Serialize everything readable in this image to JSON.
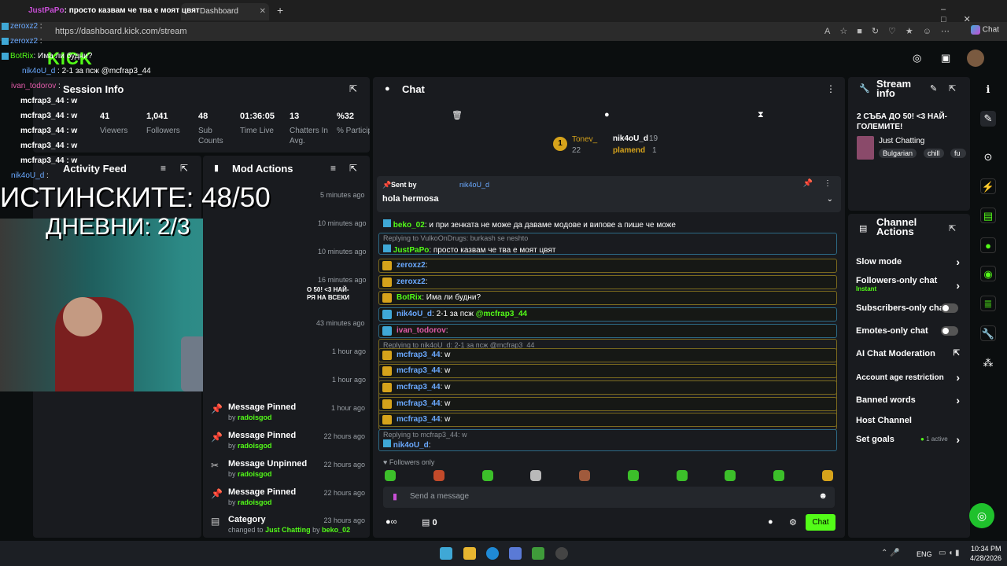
{
  "browser": {
    "tab_title": "Dashboard",
    "url": "https://dashboard.kick.com/stream",
    "chat_button": "Chat"
  },
  "overlay": {
    "top_line_name": "JustPaPo",
    "top_line_text": "просто казвам че тва е моят цвят",
    "lines": [
      {
        "name": "zeroxz2",
        "text": ":"
      },
      {
        "name": "zeroxz2",
        "text": ":"
      },
      {
        "name": "BotRix",
        "text": ": Има ли будни?"
      },
      {
        "name": "nik4oU_d",
        "text": ": 2-1 за псж @mcfrap3_44"
      },
      {
        "name": "ivan_todorov",
        "text": ":"
      },
      {
        "name": "mcfrap3_44",
        "text": ": w"
      },
      {
        "name": "mcfrap3_44",
        "text": ": w"
      },
      {
        "name": "mcfrap3_44",
        "text": ": w"
      },
      {
        "name": "mcfrap3_44",
        "text": ": w"
      },
      {
        "name": "mcfrap3_44",
        "text": ": w"
      },
      {
        "name": "nik4oU_d",
        "text": ":"
      }
    ],
    "big_line1": "ИСТИНСКИТЕ: 48/50",
    "big_line2": "ДНЕВНИ: 2/3"
  },
  "session": {
    "title": "Session Info",
    "stats": [
      {
        "value": "41",
        "label": "Viewers"
      },
      {
        "value": "1,041",
        "label": "Followers"
      },
      {
        "value": "48",
        "label": "Sub Counts"
      },
      {
        "value": "01:36:05",
        "label": "Time Live"
      },
      {
        "value": "13",
        "label": "Chatters In Avg."
      },
      {
        "value": "%32",
        "label": "% Participat"
      }
    ]
  },
  "activity": {
    "title": "Activity Feed"
  },
  "mod_actions": {
    "title": "Mod Actions",
    "partial_text1": "О 50! <3 НАЙ-",
    "partial_text2": "РЯ НА ВСЕКИ",
    "times_top": [
      "5 minutes ago",
      "10 minutes ago",
      "10 minutes ago",
      "16 minutes ago",
      "43 minutes ago",
      "1 hour ago",
      "1 hour ago"
    ],
    "rows": [
      {
        "title": "Message Pinned",
        "by": "by",
        "user": "radoisgod",
        "time": "1 hour ago"
      },
      {
        "title": "Message Pinned",
        "by": "by",
        "user": "radoisgod",
        "time": "22 hours ago"
      },
      {
        "title": "Message Unpinned",
        "by": "by",
        "user": "radoisgod",
        "time": "22 hours ago"
      },
      {
        "title": "Message Pinned",
        "by": "by",
        "user": "radoisgod",
        "time": "22 hours ago"
      },
      {
        "title": "Category",
        "by": "changed to",
        "user": "Just Chatting",
        "by2": "by",
        "user2": "beko_02",
        "time": "23 hours ago"
      }
    ]
  },
  "chat": {
    "title": "Chat",
    "top_gifter": {
      "rank": "1",
      "name": "Tonev_",
      "count": "22"
    },
    "top_users": [
      {
        "name": "nik4oU_d",
        "count": "19"
      },
      {
        "name": "plamend",
        "count": "1"
      }
    ],
    "pinned": {
      "label": "Sent by",
      "user": "nik4oU_d",
      "text": "hola hermosa"
    },
    "first_message": {
      "user": "beko_02",
      "text": ": и при зенката не може да даваме модове и випове а пише че може"
    },
    "reply1": "Replying to VulkoOnDrugs: burkash se neshto",
    "messages": [
      {
        "user": "JustPaPo",
        "text": ": просто казвам че тва е моят цвят",
        "style": "blue"
      },
      {
        "user": "zeroxz2",
        "text": ":",
        "style": "gold"
      },
      {
        "user": "zeroxz2",
        "text": ":",
        "style": "gold"
      },
      {
        "user": "BotRix",
        "text": ": Има ли будни?",
        "style": "gold"
      },
      {
        "user": "nik4oU_d",
        "text": ": 2-1 за псж",
        "mention": "@mcfrap3_44",
        "style": "blue"
      },
      {
        "user": "ivan_todorov",
        "text": ":",
        "style": "blue"
      }
    ],
    "reply2": "Replying to nik4oU_d: 2-1 за псж @mcfrap3_44",
    "w_messages": [
      {
        "user": "mcfrap3_44",
        "text": ": w"
      },
      {
        "user": "mcfrap3_44",
        "text": ": w"
      },
      {
        "user": "mcfrap3_44",
        "text": ": w"
      },
      {
        "user": "mcfrap3_44",
        "text": ": w"
      },
      {
        "user": "mcfrap3_44",
        "text": ": w"
      }
    ],
    "reply3": "Replying to mcfrap3_44: w",
    "last_message": {
      "user": "nik4oU_d",
      "text": ":"
    },
    "followers_only": "Followers only",
    "input_placeholder": "Send a message",
    "infinity": "∞",
    "counter": "0",
    "send_label": "Chat"
  },
  "stream_info": {
    "title": "Stream info",
    "stream_title": "2 СЪБА ДО 50! <3 НАЙ-ГОЛЕМИТЕ!",
    "category": "Just Chatting",
    "tags": [
      "Bulgarian",
      "chill",
      "fu"
    ]
  },
  "channel_actions": {
    "title": "Channel Actions",
    "slow_mode": "Slow mode",
    "followers_only": "Followers-only chat",
    "followers_only_sub": "Instant",
    "subscribers_only": "Subscribers-only chat",
    "emotes_only": "Emotes-only chat",
    "ai_moderation": "AI Chat Moderation",
    "account_age": "Account age restriction",
    "banned_words": "Banned words",
    "host_channel": "Host Channel",
    "set_goals": "Set goals",
    "set_goals_status": "1 active"
  },
  "taskbar": {
    "lang": "ENG",
    "time": "10:34 PM",
    "date": "4/28/2026"
  },
  "colors": {
    "kick_green": "#53fc18",
    "gold_border": "#7b6a1e",
    "blue_border": "#2c6a86"
  }
}
